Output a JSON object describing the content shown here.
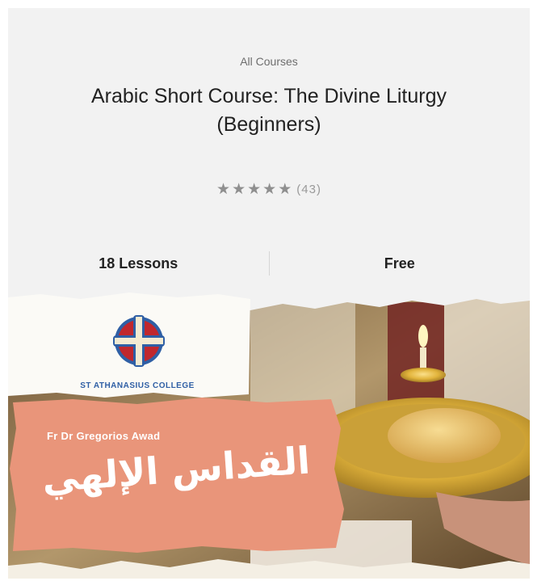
{
  "course": {
    "breadcrumb": "All Courses",
    "title": "Arabic Short Course: The Divine Liturgy (Beginners)",
    "rating": {
      "stars": 5,
      "count": "(43)"
    },
    "lessons": "18 Lessons",
    "price": "Free"
  },
  "banner": {
    "college_name": "ST ATHANASIUS COLLEGE",
    "presenter": "Fr Dr Gregorios Awad",
    "arabic_title": "القداس الإلهي"
  },
  "colors": {
    "card_bg": "#f2f2f2",
    "salmon": "#e9957a",
    "logo_red": "#c0272d",
    "logo_blue": "#2f5fa5",
    "gold": "#d8b23a"
  },
  "icons": [
    "star-icon",
    "cross-logo-icon"
  ]
}
